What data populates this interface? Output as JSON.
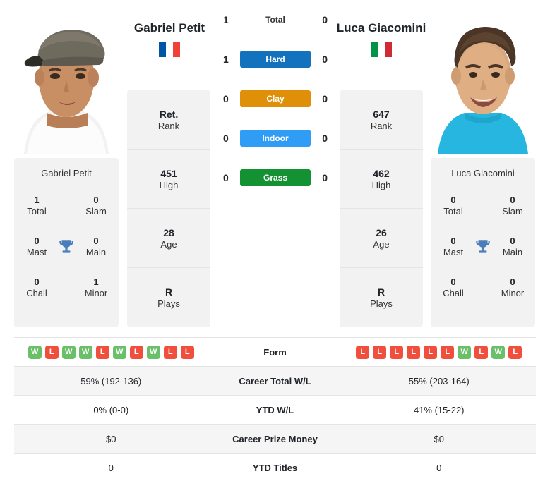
{
  "players": {
    "left": {
      "name": "Gabriel Petit",
      "country": "France",
      "flag_colors": [
        "#0055A4",
        "#FFFFFF",
        "#EF4135"
      ],
      "photo_alt": "Gabriel Petit headshot",
      "titles_heading": "Gabriel Petit",
      "titles": [
        {
          "value": "1",
          "label": "Total"
        },
        {
          "value": "0",
          "label": "Slam"
        },
        {
          "value": "0",
          "label": "Mast"
        },
        {
          "value": "0",
          "label": "Main"
        },
        {
          "value": "0",
          "label": "Chall"
        },
        {
          "value": "1",
          "label": "Minor"
        }
      ],
      "stats": [
        {
          "value": "Ret.",
          "label": "Rank"
        },
        {
          "value": "451",
          "label": "High"
        },
        {
          "value": "28",
          "label": "Age"
        },
        {
          "value": "R",
          "label": "Plays"
        }
      ],
      "form": [
        "W",
        "L",
        "W",
        "W",
        "L",
        "W",
        "L",
        "W",
        "L",
        "L"
      ],
      "career_total_wl": "59% (192-136)",
      "ytd_wl": "0% (0-0)",
      "career_prize_money": "$0",
      "ytd_titles": "0"
    },
    "right": {
      "name": "Luca Giacomini",
      "country": "Italy",
      "flag_colors": [
        "#009246",
        "#FFFFFF",
        "#CE2B37"
      ],
      "photo_alt": "Luca Giacomini headshot",
      "titles_heading": "Luca Giacomini",
      "titles": [
        {
          "value": "0",
          "label": "Total"
        },
        {
          "value": "0",
          "label": "Slam"
        },
        {
          "value": "0",
          "label": "Mast"
        },
        {
          "value": "0",
          "label": "Main"
        },
        {
          "value": "0",
          "label": "Chall"
        },
        {
          "value": "0",
          "label": "Minor"
        }
      ],
      "stats": [
        {
          "value": "647",
          "label": "Rank"
        },
        {
          "value": "462",
          "label": "High"
        },
        {
          "value": "26",
          "label": "Age"
        },
        {
          "value": "R",
          "label": "Plays"
        }
      ],
      "form": [
        "L",
        "L",
        "L",
        "L",
        "L",
        "L",
        "W",
        "L",
        "W",
        "L"
      ],
      "career_total_wl": "55% (203-164)",
      "ytd_wl": "41% (15-22)",
      "career_prize_money": "$0",
      "ytd_titles": "0"
    }
  },
  "head_to_head": [
    {
      "label": "Total",
      "left": "1",
      "right": "0",
      "surface": false,
      "color": ""
    },
    {
      "label": "Hard",
      "left": "1",
      "right": "0",
      "surface": true,
      "color": "#1272bd"
    },
    {
      "label": "Clay",
      "left": "0",
      "right": "0",
      "surface": true,
      "color": "#e09008"
    },
    {
      "label": "Indoor",
      "left": "0",
      "right": "0",
      "surface": true,
      "color": "#2f9cf5"
    },
    {
      "label": "Grass",
      "left": "0",
      "right": "0",
      "surface": true,
      "color": "#149133"
    }
  ],
  "comparison_rows": [
    {
      "label": "Form",
      "type": "form"
    },
    {
      "label": "Career Total W/L",
      "type": "text",
      "left": "59% (192-136)",
      "right": "55% (203-164)"
    },
    {
      "label": "YTD W/L",
      "type": "text",
      "left": "0% (0-0)",
      "right": "41% (15-22)"
    },
    {
      "label": "Career Prize Money",
      "type": "text",
      "left": "$0",
      "right": "$0"
    },
    {
      "label": "YTD Titles",
      "type": "text",
      "left": "0",
      "right": "0"
    }
  ],
  "icons": {
    "trophy": "trophy-icon",
    "trophy_color": "#4a7ebb"
  },
  "theme": {
    "card_bg": "#f2f2f2",
    "row_alt_bg": "#f5f5f5",
    "border": "#e4e4e4",
    "win_badge": "#6abf69",
    "loss_badge": "#ef4f3c"
  }
}
